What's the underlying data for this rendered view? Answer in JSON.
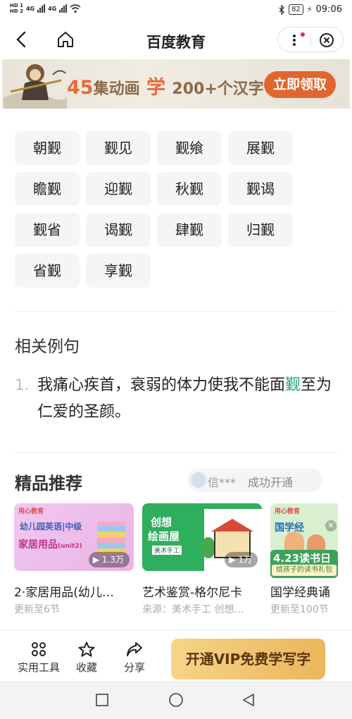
{
  "status_bar": {
    "sim1": "HD 1",
    "sim2": "HD 2",
    "network": "4G",
    "battery": "82",
    "time": "09:06"
  },
  "nav": {
    "title": "百度教育"
  },
  "banner": {
    "episodes": "45",
    "text1": "集动画",
    "text2": "学",
    "text3": "200+",
    "text4": "个汉字",
    "cta": "立即领取"
  },
  "words": [
    "朝觐",
    "觐见",
    "觐飨",
    "展觐",
    "瞻觐",
    "迎觐",
    "秋觐",
    "觐谒",
    "觐省",
    "谒觐",
    "肆觐",
    "归觐",
    "省觐",
    "享觐"
  ],
  "examples": {
    "title": "相关例句",
    "items": [
      {
        "num": "1.",
        "before": "我痛心疾首，衰弱的体力使我不能面",
        "highlight": "觐",
        "after": "至为仁爱的圣颜。"
      }
    ]
  },
  "recommend": {
    "title": "精品推荐",
    "marquee_user": "信***",
    "marquee_msg": "成功开通",
    "cards": [
      {
        "title": "2·家居用品(幼儿…",
        "sub": "更新至6节",
        "views": "1.3万",
        "brand": "用心教育",
        "img_line1": "幼儿园英语|中级",
        "img_line2": "家居用品",
        "img_line3": "(unit2)"
      },
      {
        "title": "艺术鉴赏-格尔尼卡",
        "sub": "来源：美术手工 创想…",
        "views": "1万",
        "img_line1": "创想",
        "img_line2": "绘画屋",
        "img_line3": "美术手工"
      },
      {
        "title": "国学经典诵",
        "sub": "更新至100节",
        "brand": "用心教育",
        "img_line1": "国学经",
        "promo1": "4.23读书日",
        "promo2": "给孩子的读书礼包"
      }
    ]
  },
  "bottom_bar": {
    "tools_label": "实用工具",
    "favorite_label": "收藏",
    "share_label": "分享",
    "vip_label": "开通VIP免费学写字"
  },
  "colors": {
    "accent_green": "#2aa67a",
    "cta_orange": "#e1652f",
    "vip_gold": "#eab65a"
  }
}
